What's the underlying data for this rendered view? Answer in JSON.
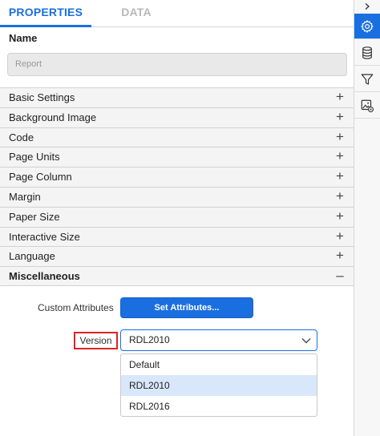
{
  "tabs": {
    "properties": "PROPERTIES",
    "data": "DATA"
  },
  "name_section": {
    "label": "Name",
    "placeholder": "Report"
  },
  "sections": [
    {
      "label": "Basic Settings",
      "toggle": "+"
    },
    {
      "label": "Background Image",
      "toggle": "+"
    },
    {
      "label": "Code",
      "toggle": "+"
    },
    {
      "label": "Page Units",
      "toggle": "+"
    },
    {
      "label": "Page Column",
      "toggle": "+"
    },
    {
      "label": "Margin",
      "toggle": "+"
    },
    {
      "label": "Paper Size",
      "toggle": "+"
    },
    {
      "label": "Interactive Size",
      "toggle": "+"
    },
    {
      "label": "Language",
      "toggle": "+"
    },
    {
      "label": "Miscellaneous",
      "toggle": "–"
    }
  ],
  "misc": {
    "custom_attributes_label": "Custom Attributes",
    "set_attributes_button": "Set Attributes...",
    "version_label": "Version",
    "version_value": "RDL2010",
    "version_options": [
      "Default",
      "RDL2010",
      "RDL2016"
    ],
    "selected_option": "RDL2010"
  },
  "rail": {
    "collapse_icon": "chevron-right-icon",
    "items": [
      "gear-icon",
      "database-icon",
      "filter-icon",
      "image-settings-icon"
    ],
    "active_item": "gear-icon",
    "accent_color": "#1a6fe0"
  },
  "colors": {
    "accent": "#1a6fe0",
    "highlight_border": "#e0212b",
    "selected_option_bg": "#d9e7fb"
  }
}
